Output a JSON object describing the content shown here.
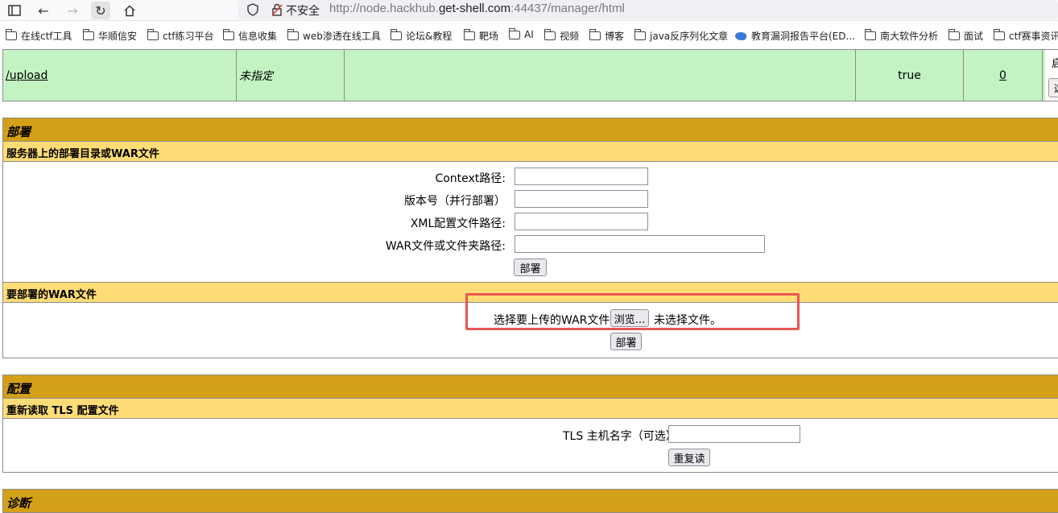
{
  "browser": {
    "insecure_label": "不安全",
    "url_prefix": "http://node.hackhub.",
    "url_domain": "get-shell.com",
    "url_suffix": ":44437/manager/html"
  },
  "bookmarks": [
    "在线ctf工具",
    "华顺信安",
    "ctf练习平台",
    "信息收集",
    "web渗透在线工具",
    "论坛&教程",
    "靶场",
    "AI",
    "视频",
    "博客",
    "java反序列化文章",
    "教育漏洞报告平台(ED...",
    "南大软件分析",
    "面试",
    "ctf赛事资讯"
  ],
  "app_row": {
    "path": "/upload",
    "display_name": "未指定",
    "running": "true",
    "sessions": "0",
    "start_label": "启",
    "start_btn": "这"
  },
  "deploy": {
    "title": "部署",
    "server_subtitle": "服务器上的部署目录或WAR文件",
    "context_label": "Context路径:",
    "version_label": "版本号（并行部署）",
    "xml_label": "XML配置文件路径:",
    "war_label": "WAR文件或文件夹路径:",
    "deploy_button": "部署",
    "war_subtitle": "要部署的WAR文件",
    "choose_label": "选择要上传的WAR文件",
    "browse_button": "浏览...",
    "no_file": "未选择文件。",
    "upload_button": "部署"
  },
  "config": {
    "title": "配置",
    "tls_subtitle": "重新读取 TLS 配置文件",
    "tls_label": "TLS 主机名字（可选）",
    "reread_button": "重复读"
  },
  "diagnostics": {
    "title": "诊断"
  }
}
